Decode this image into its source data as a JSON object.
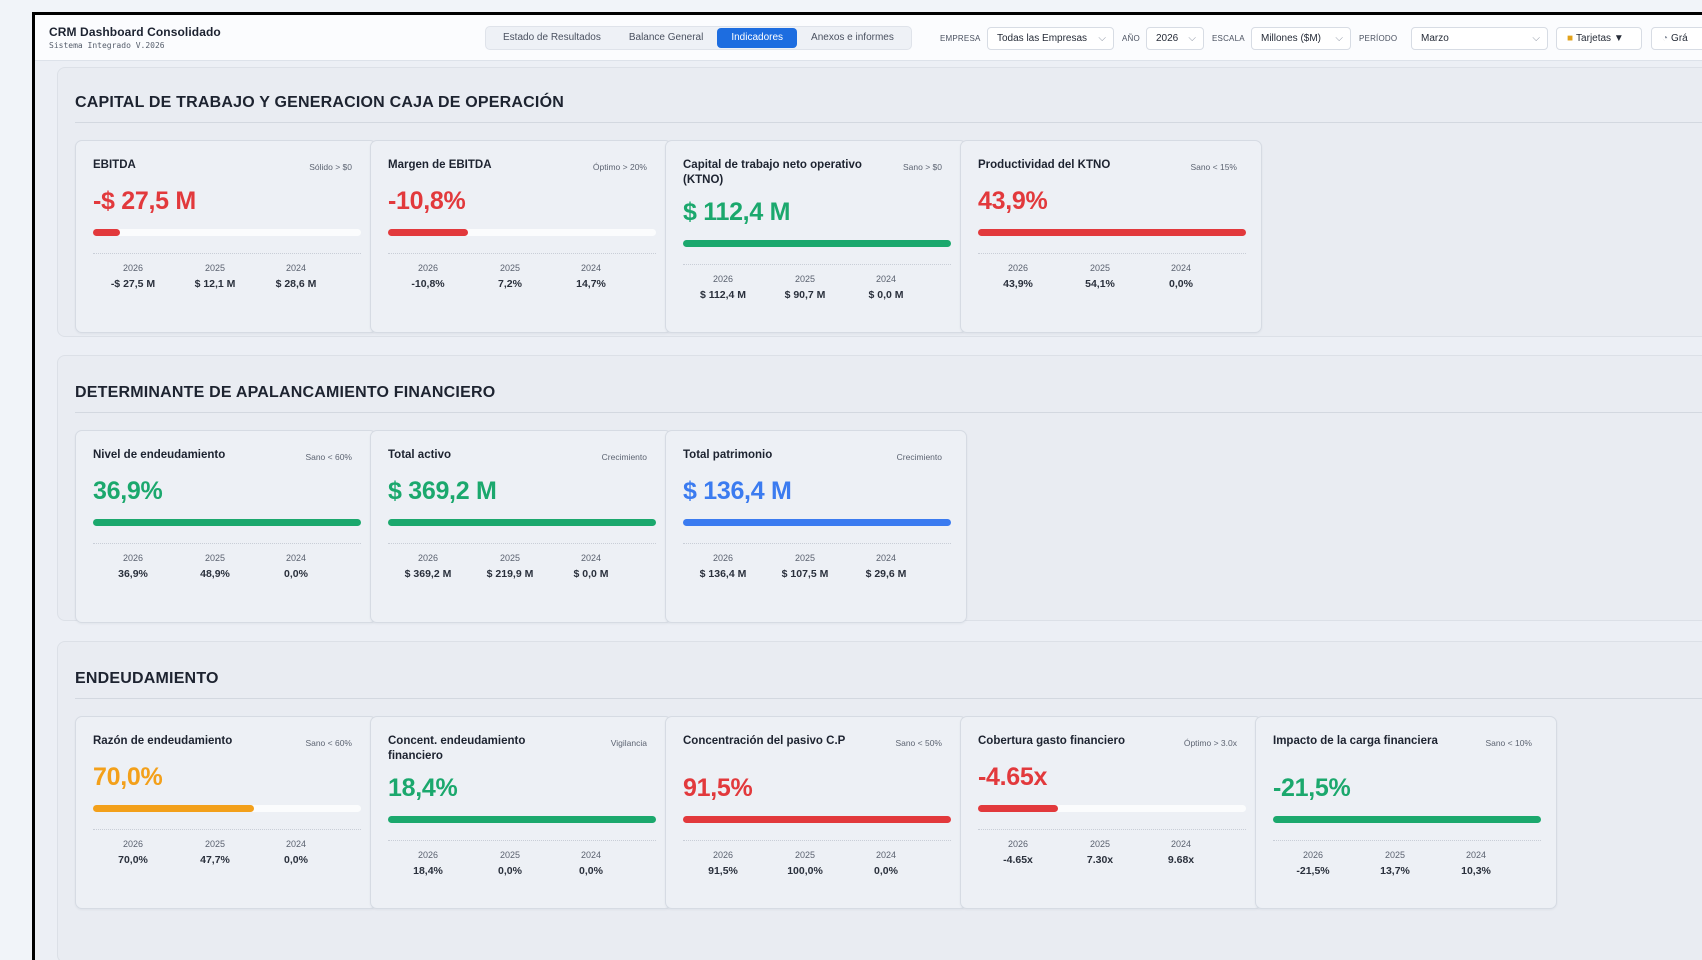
{
  "app": {
    "title": "CRM Dashboard Consolidado",
    "subtitle": "Sistema Integrado V.2026"
  },
  "tabs": [
    "Estado de Resultados",
    "Balance General",
    "Indicadores",
    "Anexos e informes"
  ],
  "filters": {
    "empresa": {
      "label": "EMPRESA",
      "value": "Todas las Empresas"
    },
    "anio": {
      "label": "AÑO",
      "value": "2026"
    },
    "escala": {
      "label": "ESCALA",
      "value": "Millones ($M)"
    },
    "periodo": {
      "label": "PERÍODO",
      "value": "Marzo"
    }
  },
  "buttons": {
    "tarjetas": "Tarjetas ▼",
    "graficos": "Grá"
  },
  "icons": {
    "chevron": "chevron-down-icon",
    "tarjetas": "cards-icon",
    "graficos": "chart-icon"
  },
  "colors": {
    "red": "#e2393c",
    "green": "#1ba86d",
    "blue": "#3b7bf0",
    "orange": "#f3a01a",
    "active_tab": "#1d6de0"
  },
  "sections": [
    {
      "title": "CAPITAL DE TRABAJO Y GENERACION CAJA DE OPERACIÓN",
      "cards": [
        {
          "title": "EBITDA",
          "badge": "Sólido > $0",
          "value": "-$ 27,5 M",
          "color": "red",
          "progress": 0.1,
          "years": [
            "2026",
            "2025",
            "2024"
          ],
          "values": [
            "-$ 27,5 M",
            "$ 12,1 M",
            "$ 28,6 M"
          ]
        },
        {
          "title": "Margen de EBITDA",
          "badge": "Óptimo > 20%",
          "value": "-10,8%",
          "color": "red",
          "progress": 0.3,
          "years": [
            "2026",
            "2025",
            "2024"
          ],
          "values": [
            "-10,8%",
            "7,2%",
            "14,7%"
          ]
        },
        {
          "title": "Capital de trabajo neto operativo (KTNO)",
          "badge": "Sano > $0",
          "value": "$ 112,4 M",
          "color": "green",
          "progress": 1.0,
          "years": [
            "2026",
            "2025",
            "2024"
          ],
          "values": [
            "$ 112,4 M",
            "$ 90,7 M",
            "$ 0,0 M"
          ]
        },
        {
          "title": "Productividad del KTNO",
          "badge": "Sano < 15%",
          "value": "43,9%",
          "color": "red",
          "progress": 1.0,
          "years": [
            "2026",
            "2025",
            "2024"
          ],
          "values": [
            "43,9%",
            "54,1%",
            "0,0%"
          ]
        }
      ]
    },
    {
      "title": "DETERMINANTE DE APALANCAMIENTO FINANCIERO",
      "cards": [
        {
          "title": "Nivel de endeudamiento",
          "badge": "Sano < 60%",
          "value": "36,9%",
          "color": "green",
          "progress": 1.0,
          "years": [
            "2026",
            "2025",
            "2024"
          ],
          "values": [
            "36,9%",
            "48,9%",
            "0,0%"
          ]
        },
        {
          "title": "Total activo",
          "badge": "Crecimiento",
          "value": "$ 369,2 M",
          "color": "green",
          "progress": 1.0,
          "years": [
            "2026",
            "2025",
            "2024"
          ],
          "values": [
            "$ 369,2 M",
            "$ 219,9 M",
            "$ 0,0 M"
          ]
        },
        {
          "title": "Total patrimonio",
          "badge": "Crecimiento",
          "value": "$ 136,4 M",
          "color": "blue",
          "progress": 1.0,
          "years": [
            "2026",
            "2025",
            "2024"
          ],
          "values": [
            "$ 136,4 M",
            "$ 107,5 M",
            "$ 29,6 M"
          ]
        }
      ]
    },
    {
      "title": "ENDEUDAMIENTO",
      "cards": [
        {
          "title": "Razón de endeudamiento",
          "badge": "Sano < 60%",
          "value": "70,0%",
          "color": "orange",
          "progress": 0.6,
          "years": [
            "2026",
            "2025",
            "2024"
          ],
          "values": [
            "70,0%",
            "47,7%",
            "0,0%"
          ]
        },
        {
          "title": "Concent. endeudamiento financiero",
          "badge": "Vigilancia",
          "value": "18,4%",
          "color": "green",
          "progress": 1.0,
          "years": [
            "2026",
            "2025",
            "2024"
          ],
          "values": [
            "18,4%",
            "0,0%",
            "0,0%"
          ]
        },
        {
          "title": "Concentración del pasivo C.P",
          "badge": "Sano < 50%",
          "value": "91,5%",
          "color": "red",
          "progress": 1.0,
          "years": [
            "2026",
            "2025",
            "2024"
          ],
          "values": [
            "91,5%",
            "100,0%",
            "0,0%"
          ]
        },
        {
          "title": "Cobertura gasto financiero",
          "badge": "Óptimo > 3.0x",
          "value": "-4.65x",
          "color": "red",
          "progress": 0.3,
          "years": [
            "2026",
            "2025",
            "2024"
          ],
          "values": [
            "-4.65x",
            "7.30x",
            "9.68x"
          ]
        },
        {
          "title": "Impacto de la carga financiera",
          "badge": "Sano < 10%",
          "value": "-21,5%",
          "color": "green",
          "progress": 1.0,
          "years": [
            "2026",
            "2025",
            "2024"
          ],
          "values": [
            "-21,5%",
            "13,7%",
            "10,3%"
          ]
        }
      ]
    }
  ]
}
